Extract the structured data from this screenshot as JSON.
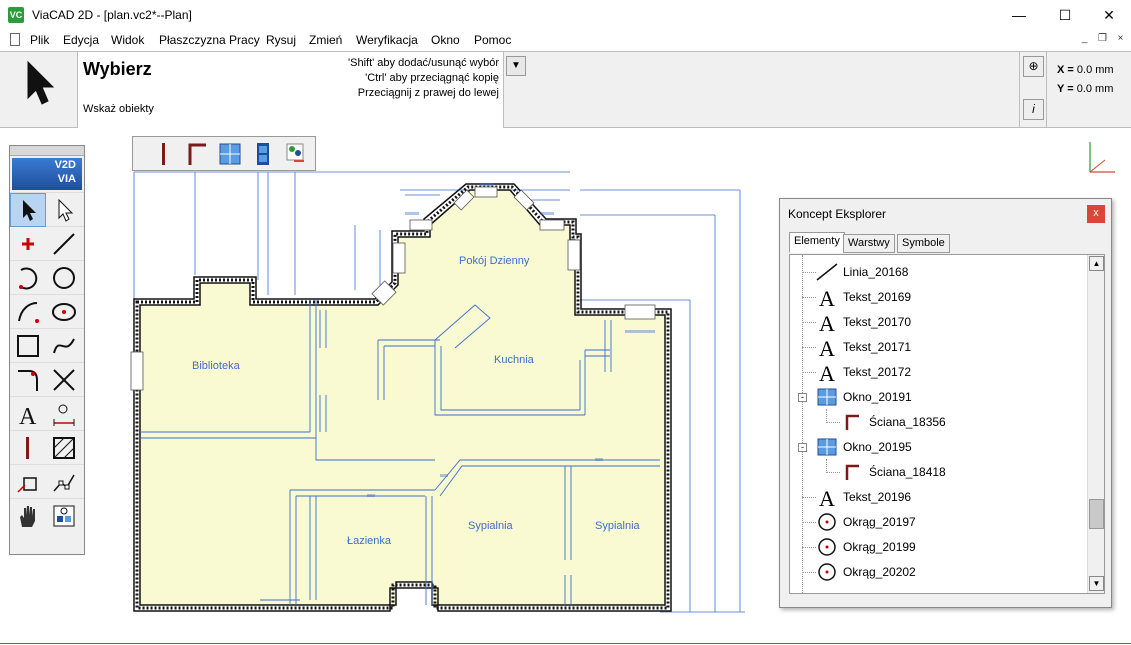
{
  "window": {
    "app_icon": "VC",
    "title": "ViaCAD 2D - [plan.vc2*--Plan]",
    "minimize": "—",
    "maximize": "☐",
    "close": "✕"
  },
  "menu": {
    "items": [
      "Plik",
      "Edycja",
      "Widok",
      "Płaszczyzna Pracy",
      "Rysuj",
      "Zmień",
      "Weryfikacja",
      "Okno",
      "Pomoc"
    ],
    "mdi_minimize": "_",
    "mdi_restore": "❐",
    "mdi_close": "×"
  },
  "prompt": {
    "title": "Wybierz",
    "subtitle": "Wskaż obiekty",
    "hints": [
      "'Shift' aby dodać/usunąć wybór",
      "'Ctrl' aby przeciągnąć kopię",
      "Przeciągnij z prawej do lewej"
    ],
    "dropdown_glyph": "▼",
    "coord_x_label": "X =",
    "coord_x": "0.0 mm",
    "coord_y_label": "Y =",
    "coord_y": "0.0 mm",
    "info_glyph": "i",
    "target_glyph": "⊕"
  },
  "palette": {
    "logo_line1": "V2D",
    "logo_line2": "VIA"
  },
  "plan": {
    "rooms": [
      "Pokój Dzienny",
      "Biblioteka",
      "Kuchnia",
      "Łazienka",
      "Sypialnia",
      "Sypialnia"
    ]
  },
  "explorer": {
    "title": "Koncept Eksplorer",
    "close_glyph": "x",
    "tabs": [
      "Elementy",
      "Warstwy",
      "Symbole"
    ],
    "items": [
      {
        "icon": "line-icon",
        "label": "Linia_20168",
        "level": 0
      },
      {
        "icon": "text-icon",
        "label": "Tekst_20169",
        "level": 0
      },
      {
        "icon": "text-icon",
        "label": "Tekst_20170",
        "level": 0
      },
      {
        "icon": "text-icon",
        "label": "Tekst_20171",
        "level": 0
      },
      {
        "icon": "text-icon",
        "label": "Tekst_20172",
        "level": 0
      },
      {
        "icon": "window-icon",
        "label": "Okno_20191",
        "level": 0
      },
      {
        "icon": "wall-icon",
        "label": "Ściana_18356",
        "level": 1
      },
      {
        "icon": "window-icon",
        "label": "Okno_20195",
        "level": 0
      },
      {
        "icon": "wall-icon",
        "label": "Ściana_18418",
        "level": 1
      },
      {
        "icon": "text-icon",
        "label": "Tekst_20196",
        "level": 0
      },
      {
        "icon": "circle-icon",
        "label": "Okrąg_20197",
        "level": 0
      },
      {
        "icon": "circle-icon",
        "label": "Okrąg_20199",
        "level": 0
      },
      {
        "icon": "circle-icon",
        "label": "Okrąg_20202",
        "level": 0
      }
    ],
    "scroll_up": "▲",
    "scroll_down": "▼"
  },
  "colors": {
    "floor_fill": "#fafad2",
    "dimension_blue": "#3a6fcf",
    "selection": "#b9d4f0"
  }
}
